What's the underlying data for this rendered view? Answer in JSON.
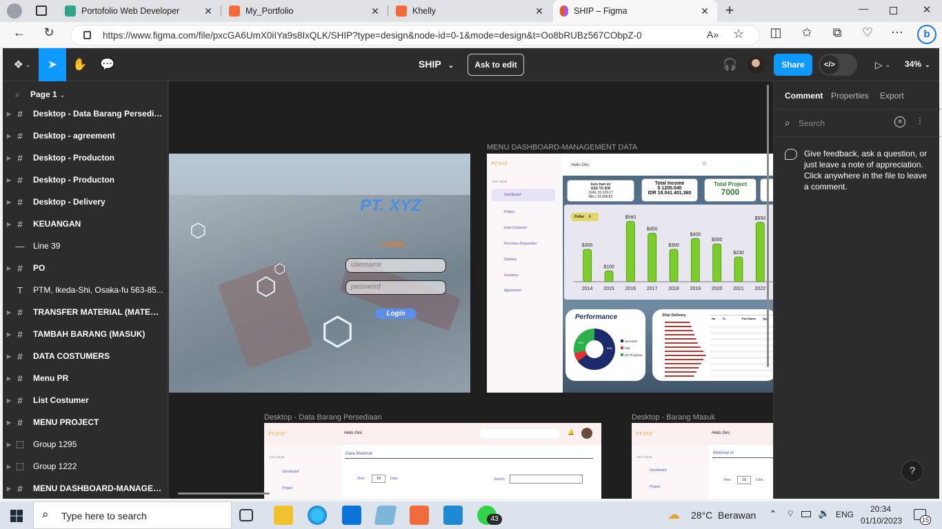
{
  "browser": {
    "tabs": [
      {
        "title": "Portofolio Web Developer",
        "color": "#35a387"
      },
      {
        "title": "My_Portfolio",
        "color": "#f26b3a"
      },
      {
        "title": "Khelly",
        "color": "#f26b3a"
      },
      {
        "title": "SHIP – Figma",
        "color": "#f24e1e"
      }
    ],
    "url": "https://www.figma.com/file/pxcGA6UmX0iIYa9s8IxQLK/SHIP?type=design&node-id=0-1&mode=design&t=Oo8bRUBz567CObpZ-0"
  },
  "figma": {
    "file_title": "SHIP",
    "ask_to_edit": "Ask to edit",
    "share": "Share",
    "zoom": "34%",
    "page": "Page 1",
    "layers": [
      {
        "name": "Desktop - Data Barang Persediaan",
        "icon": "#"
      },
      {
        "name": "Desktop - agreement",
        "icon": "#"
      },
      {
        "name": "Desktop - Producton",
        "icon": "#"
      },
      {
        "name": "Desktop - Producton",
        "icon": "#"
      },
      {
        "name": "Desktop - Delivery",
        "icon": "#"
      },
      {
        "name": "KEUANGAN",
        "icon": "#"
      },
      {
        "name": "Line 39",
        "icon": "—"
      },
      {
        "name": "PO",
        "icon": "#"
      },
      {
        "name": "PTM, Ikeda-Shi, Osaka-fu 563-85...",
        "icon": "T"
      },
      {
        "name": "TRANSFER MATERIAL (MATERIA...",
        "icon": "#"
      },
      {
        "name": "TAMBAH BARANG (MASUK)",
        "icon": "#"
      },
      {
        "name": "DATA COSTUMERS",
        "icon": "#"
      },
      {
        "name": "Menu PR",
        "icon": "#"
      },
      {
        "name": "List Costumer",
        "icon": "#"
      },
      {
        "name": "MENU PROJECT",
        "icon": "#"
      },
      {
        "name": "Group 1295",
        "icon": "⬚"
      },
      {
        "name": "Group 1222",
        "icon": "⬚"
      },
      {
        "name": "MENU DASHBOARD-MANAGEME...",
        "icon": "#"
      }
    ],
    "right_tabs": [
      "Comment",
      "Properties",
      "Export"
    ],
    "comment_search_placeholder": "Search",
    "comment_hint": "Give feedback, ask a question, or just leave a note of appreciation. Click anywhere in the file to leave a comment.",
    "help": "?"
  },
  "canvas": {
    "login_frame": {
      "brand": "PT. XYZ",
      "login_title": "LOGIN",
      "username_placeholder": "username",
      "password_placeholder": "password",
      "login_button": "Login"
    },
    "dashboard_frame": {
      "label": "MENU DASHBOARD-MANAGEMENT DATA",
      "brand": "PT.XYZ",
      "greeting": "Hello Dini,",
      "user_panel": "User Panel",
      "menu": [
        "Dashboard",
        "Project",
        "Data Costumer",
        "Purchase Requestion",
        "Delivery",
        "Inventory",
        "Agreement"
      ],
      "kurs": {
        "line1": "kurs hari ini",
        "line2": "USD TO IDR",
        "line3": "JUAL 15.109,17",
        "line4": "BELI 14.958,83"
      },
      "income": {
        "title": "Total Income",
        "usd": "$ 1200.040",
        "idr": "IDR 18.041.401,360"
      },
      "project": {
        "title": "Total Project",
        "value": "7000"
      },
      "currency_select": "Dollar",
      "performance_title": "Performance",
      "performance_legend": [
        "Succeed",
        "Fail",
        "On Progress"
      ],
      "performance_labels": [
        "20%",
        "65%"
      ],
      "delivery_title": "Ship Delivery",
      "table_headers": [
        "No",
        "To",
        "Port Name",
        "Qty"
      ]
    },
    "persediaan_frame": {
      "label": "Desktop - Data Barang Persediaan",
      "brand": "PT.XYZ",
      "greeting": "Hello Dini,",
      "user_panel": "User Panel",
      "menu": [
        "Dashboard",
        "Project"
      ],
      "title": "Data Material",
      "view": "View",
      "view_count": "10",
      "data": "Data",
      "search": "Search:"
    },
    "masuk_frame": {
      "label": "Desktop - Barang Masuk",
      "brand": "PT.XYZ",
      "greeting": "Hello Dini,",
      "user_panel": "User Panel",
      "menu": [
        "Dashboard",
        "Project"
      ],
      "title": "Material In",
      "view": "View",
      "view_count": "10",
      "data": "Data"
    }
  },
  "chart_data": {
    "type": "bar",
    "categories": [
      "2014",
      "2015",
      "2016",
      "2017",
      "2018",
      "2019",
      "2020",
      "2021",
      "2022"
    ],
    "values": [
      300,
      100,
      560,
      450,
      300,
      400,
      350,
      230,
      550
    ],
    "value_labels": [
      "$300",
      "$100",
      "$560",
      "$450",
      "$300",
      "$400",
      "$350",
      "$230",
      "$550"
    ],
    "ylim": [
      0,
      600
    ],
    "color": "#7ccc2a"
  },
  "taskbar": {
    "search_placeholder": "Type here to search",
    "weather": "28°C  Berawan",
    "lang": "ENG",
    "time": "20:34",
    "date": "01/10/2023",
    "whatsapp_badge": "43",
    "notif_count": "15"
  }
}
